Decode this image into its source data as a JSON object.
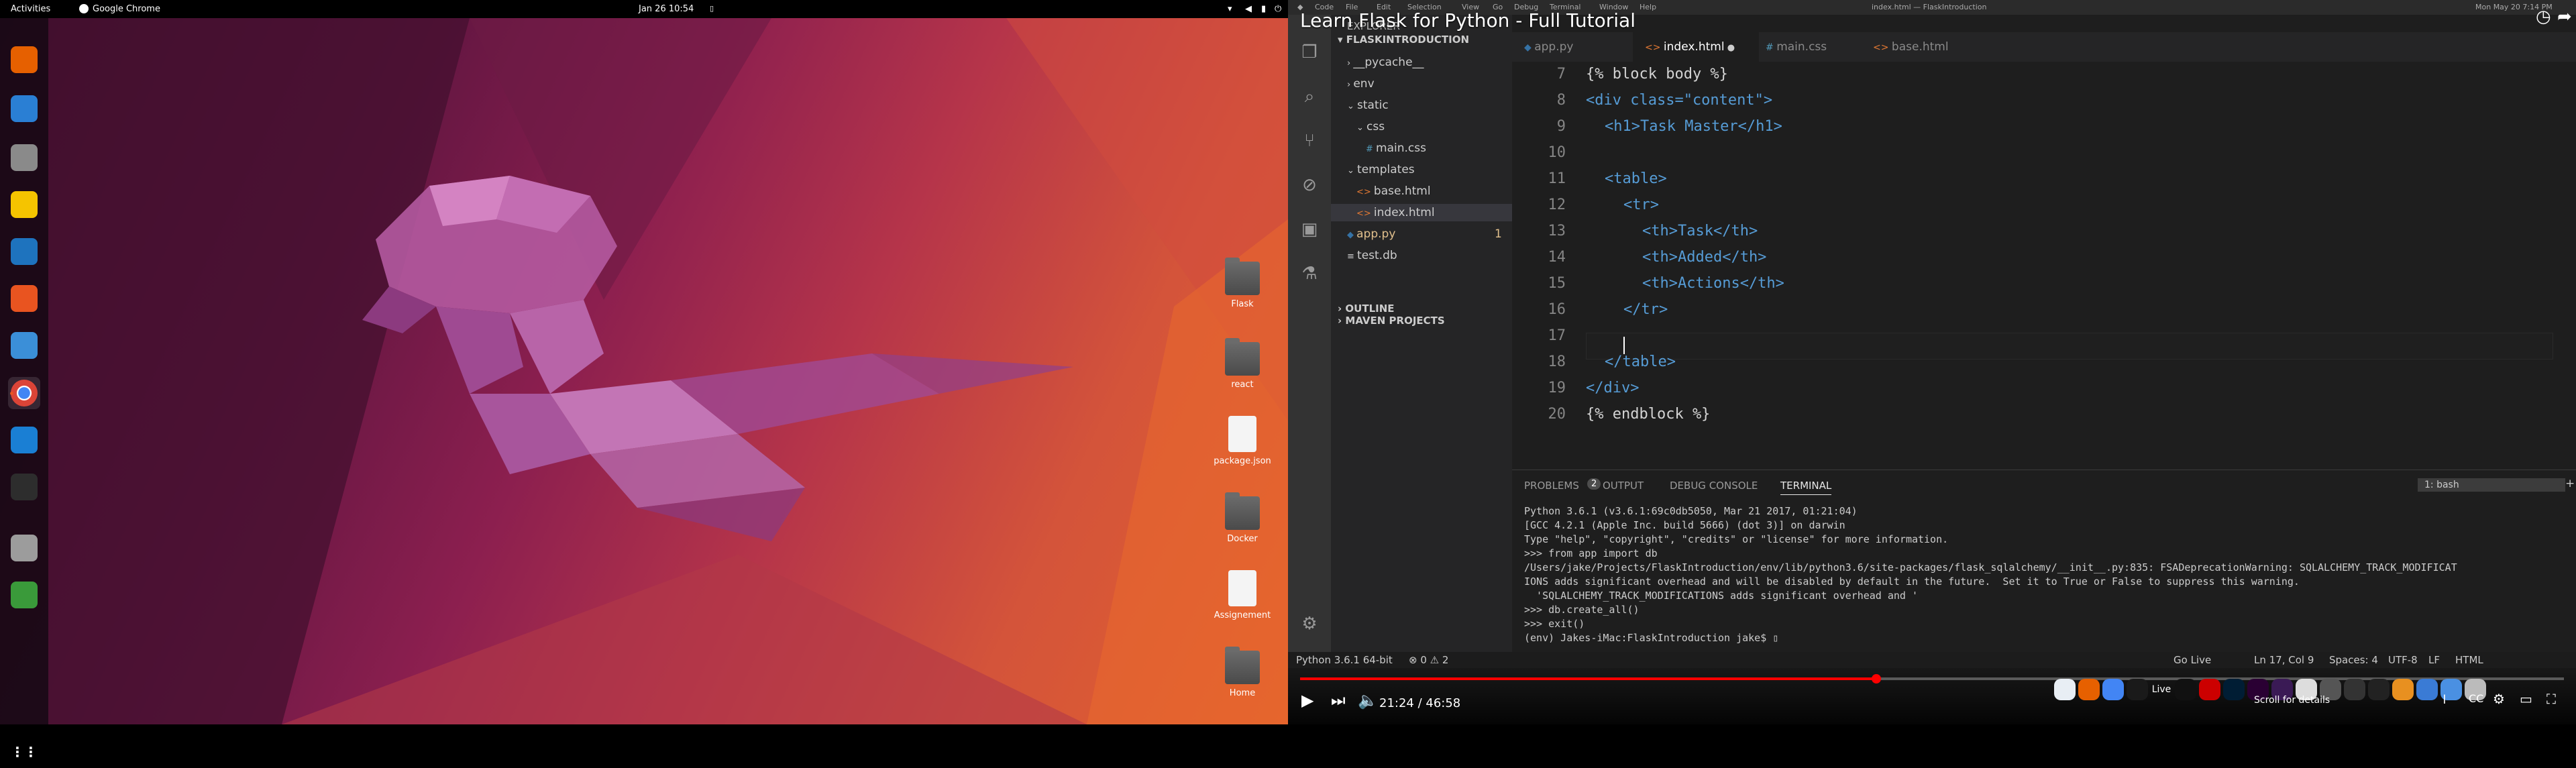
{
  "ubuntu": {
    "activities": "Activities",
    "app_name": "Google Chrome",
    "clock": "Jan 26  10:54"
  },
  "desktop_icons": [
    {
      "label": "Flask",
      "kind": "folder"
    },
    {
      "label": "react",
      "kind": "folder"
    },
    {
      "label": "package.json",
      "kind": "file"
    },
    {
      "label": "Docker",
      "kind": "folder"
    },
    {
      "label": "Assignement",
      "kind": "file"
    },
    {
      "label": "Home",
      "kind": "home"
    }
  ],
  "dock": [
    "firefox-icon",
    "thunderbird-icon",
    "files-icon",
    "rhythmbox-icon",
    "writer-icon",
    "software-icon",
    "help-icon",
    "chrome-icon",
    "vscode-icon",
    "terminal-icon",
    "disks-icon",
    "trash-icon",
    "app-grid-icon"
  ],
  "video": {
    "title": "Learn Flask for Python - Full Tutorial",
    "mac_menu": [
      "Code",
      "File",
      "Edit",
      "Selection",
      "View",
      "Go",
      "Debug",
      "Terminal",
      "Window",
      "Help"
    ],
    "window_title": "index.html — FlaskIntroduction",
    "mac_clock": "Mon May 20  7:14 PM"
  },
  "explorer": {
    "header": "EXPLORER",
    "project": "FLASKINTRODUCTION",
    "items": [
      {
        "label": "__pycache__",
        "indent": 1,
        "type": "folder"
      },
      {
        "label": "env",
        "indent": 1,
        "type": "folder"
      },
      {
        "label": "static",
        "indent": 1,
        "type": "folder-open"
      },
      {
        "label": "css",
        "indent": 2,
        "type": "folder-open"
      },
      {
        "label": "main.css",
        "indent": 3,
        "type": "css"
      },
      {
        "label": "templates",
        "indent": 1,
        "type": "folder-open"
      },
      {
        "label": "base.html",
        "indent": 2,
        "type": "html"
      },
      {
        "label": "index.html",
        "indent": 2,
        "type": "html",
        "selected": true
      },
      {
        "label": "app.py",
        "indent": 1,
        "type": "py",
        "badge": "1"
      },
      {
        "label": "test.db",
        "indent": 1,
        "type": "db"
      }
    ],
    "outline": "OUTLINE",
    "maven": "MAVEN PROJECTS"
  },
  "tabs": [
    {
      "label": "app.py",
      "active": false
    },
    {
      "label": "index.html",
      "active": true
    },
    {
      "label": "main.css",
      "active": false
    },
    {
      "label": "base.html",
      "active": false
    }
  ],
  "code": [
    {
      "n": "7",
      "text": "{% block body %}",
      "kind": "tpl",
      "indent": 0
    },
    {
      "n": "8",
      "text": "<div class=\"content\">",
      "kind": "tag",
      "indent": 0
    },
    {
      "n": "9",
      "text": "<h1>Task Master</h1>",
      "kind": "tag",
      "indent": 1
    },
    {
      "n": "10",
      "text": "",
      "kind": "tag",
      "indent": 0
    },
    {
      "n": "11",
      "text": "<table>",
      "kind": "tag",
      "indent": 1
    },
    {
      "n": "12",
      "text": "<tr>",
      "kind": "tag",
      "indent": 2
    },
    {
      "n": "13",
      "text": "<th>Task</th>",
      "kind": "tag",
      "indent": 3
    },
    {
      "n": "14",
      "text": "<th>Added</th>",
      "kind": "tag",
      "indent": 3
    },
    {
      "n": "15",
      "text": "<th>Actions</th>",
      "kind": "tag",
      "indent": 3
    },
    {
      "n": "16",
      "text": "</tr>",
      "kind": "tag",
      "indent": 2
    },
    {
      "n": "17",
      "text": "",
      "kind": "tag",
      "indent": 2
    },
    {
      "n": "18",
      "text": "</table>",
      "kind": "tag",
      "indent": 1
    },
    {
      "n": "19",
      "text": "</div>",
      "kind": "tag",
      "indent": 0
    },
    {
      "n": "20",
      "text": "{% endblock %}",
      "kind": "tpl",
      "indent": 0
    }
  ],
  "panel": {
    "tabs": [
      "PROBLEMS",
      "OUTPUT",
      "DEBUG CONSOLE",
      "TERMINAL"
    ],
    "problems_badge": "2",
    "active_tab": "TERMINAL",
    "shell": "1: bash",
    "terminal_lines": [
      "Python 3.6.1 (v3.6.1:69c0db5050, Mar 21 2017, 01:21:04)",
      "[GCC 4.2.1 (Apple Inc. build 5666) (dot 3)] on darwin",
      "Type \"help\", \"copyright\", \"credits\" or \"license\" for more information.",
      ">>> from app import db",
      "/Users/jake/Projects/FlaskIntroduction/env/lib/python3.6/site-packages/flask_sqlalchemy/__init__.py:835: FSADeprecationWarning: SQLALCHEMY_TRACK_MODIFICAT",
      "IONS adds significant overhead and will be disabled by default in the future.  Set it to True or False to suppress this warning.",
      "  'SQLALCHEMY_TRACK_MODIFICATIONS adds significant overhead and '",
      ">>> db.create_all()",
      ">>> exit()",
      "(env) Jakes-iMac:FlaskIntroduction jake$ ▯"
    ]
  },
  "status": {
    "python": "Python 3.6.1 64-bit",
    "problems": "⊗ 0 ⚠ 2",
    "golive": "Go Live",
    "position": "Ln 17, Col 9",
    "spaces": "Spaces: 4",
    "encoding": "UTF-8",
    "eol": "LF",
    "language": "HTML"
  },
  "player": {
    "time": "21:24 / 46:58",
    "progress": 0.456,
    "live_label": "Live",
    "tooltip": "Scroll for details"
  },
  "colors": {
    "accent": "#e95420",
    "yt_red": "#ff0000",
    "vscode_blue": "#007acc"
  }
}
